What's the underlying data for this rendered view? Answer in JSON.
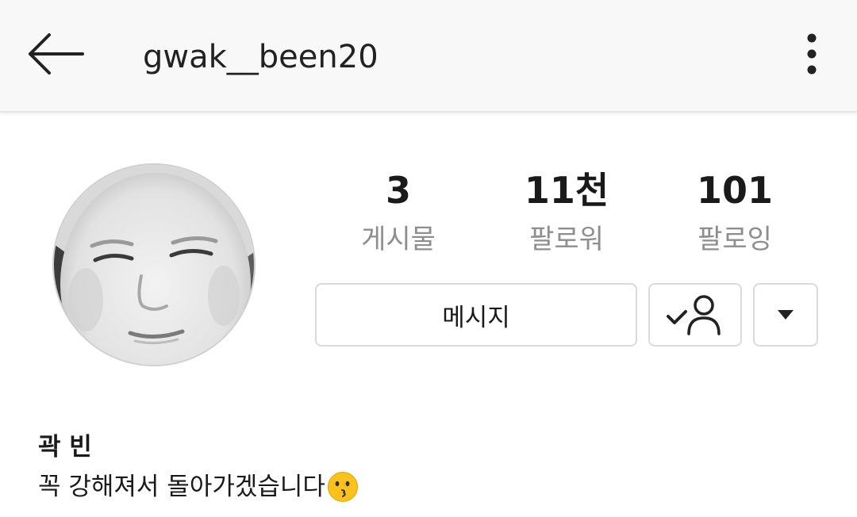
{
  "header": {
    "username": "gwak__been20",
    "back_icon": "arrow-left-icon",
    "more_icon": "vertical-dots-icon"
  },
  "profile": {
    "avatar": "profile-photo-avatar",
    "stats": {
      "posts": {
        "value": "3",
        "label": "게시물"
      },
      "followers": {
        "value": "11천",
        "label": "팔로워"
      },
      "following": {
        "value": "101",
        "label": "팔로잉"
      }
    },
    "buttons": {
      "message_label": "메시지",
      "following_icon": "person-check-icon",
      "dropdown_icon": "triangle-down-icon"
    },
    "name": "곽 빈",
    "bio_text": "꼭 강해져서 돌아가겠습니다",
    "bio_emoji": "kissing-face-emoji"
  },
  "colors": {
    "topbar_bg": "#f8f8f8",
    "text_primary": "#1a1a1a",
    "text_secondary": "#8e8e8e",
    "button_border": "#dbdbdb"
  }
}
